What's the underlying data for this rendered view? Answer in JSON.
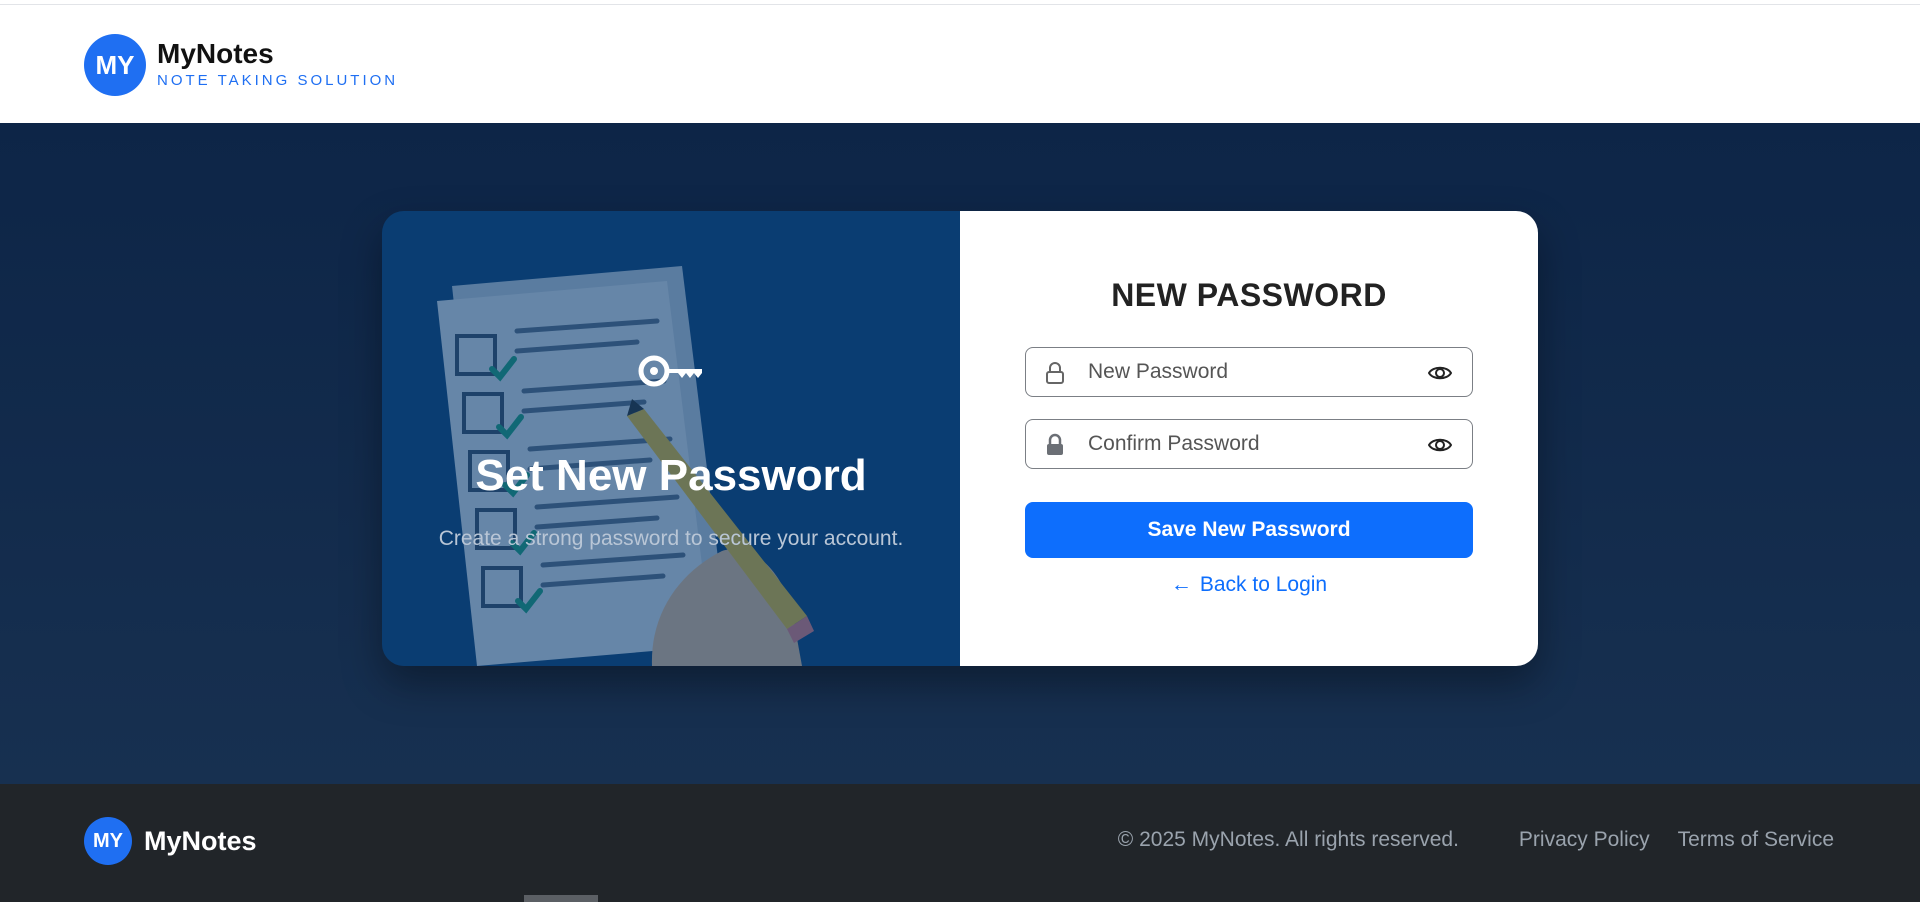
{
  "header": {
    "logo_initials": "MY",
    "brand_name": "MyNotes",
    "tagline": "NOTE TAKING SOLUTION",
    "accent_color": "#1f6ff2"
  },
  "left_panel": {
    "icon": "key-icon",
    "title": "Set New Password",
    "subtitle": "Create a strong password to secure your account.",
    "background_color": "#0a3d72"
  },
  "form": {
    "title": "NEW PASSWORD",
    "new_password": {
      "value": "",
      "placeholder": "New Password",
      "left_icon": "lock-outline-icon",
      "right_icon": "eye-icon"
    },
    "confirm_password": {
      "value": "",
      "placeholder": "Confirm Password",
      "left_icon": "lock-filled-icon",
      "right_icon": "eye-icon"
    },
    "submit_label": "Save New Password",
    "back_arrow": "←",
    "back_label": "Back to Login",
    "button_color": "#0d6efd"
  },
  "footer": {
    "logo_initials": "MY",
    "brand_name": "MyNotes",
    "copyright": "© 2025 MyNotes. All rights reserved.",
    "links": [
      "Privacy Policy",
      "Terms of Service"
    ],
    "background_color": "#212529"
  }
}
